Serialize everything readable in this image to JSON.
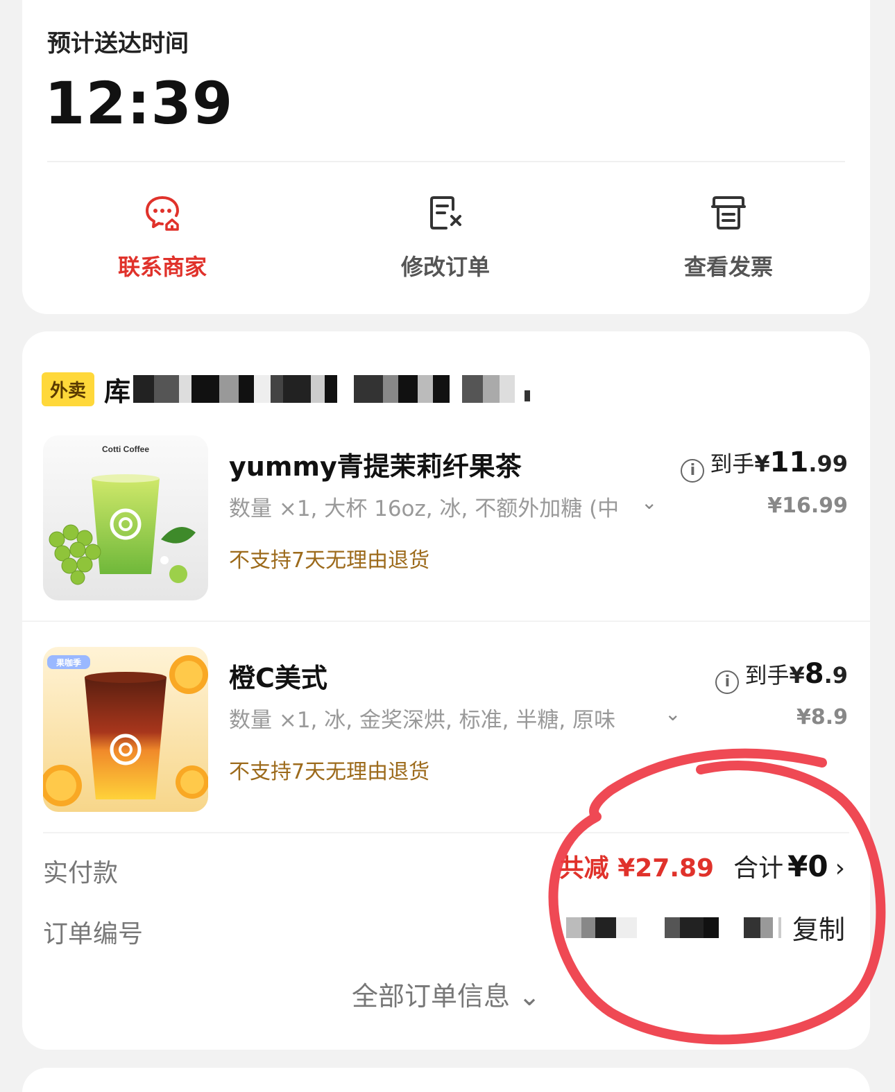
{
  "delivery": {
    "eta_label": "预计送达时间",
    "eta_time": "12:39",
    "actions": [
      {
        "label": "联系商家",
        "icon": "chat-merchant-icon",
        "color": "#e0322b"
      },
      {
        "label": "修改订单",
        "icon": "edit-order-icon"
      },
      {
        "label": "查看发票",
        "icon": "invoice-icon"
      }
    ]
  },
  "order": {
    "tag": "外卖",
    "store_name_visible": "库",
    "items": [
      {
        "name": "yummy青提茉莉纤果茶",
        "brand_text": "Cotti Coffee",
        "spec": "数量 ×1, 大杯 16oz, 冰, 不额外加糖 (中",
        "note": "不支持7天无理由退货",
        "price_prefix": "到手",
        "price_currency": "¥",
        "price_int": "11",
        "price_dec": ".99",
        "orig_price": "¥16.99"
      },
      {
        "name": "橙C美式",
        "badge_text": "果咖季",
        "spec": "数量 ×1, 冰, 金奖深烘, 标准, 半糖, 原味",
        "note": "不支持7天无理由退货",
        "price_prefix": "到手",
        "price_currency": "¥",
        "price_int": "8",
        "price_dec": ".9",
        "orig_price": "¥8.9"
      }
    ],
    "payment": {
      "label": "实付款",
      "saved_text": "共减 ¥27.89",
      "total_label": "合计",
      "total_value": "¥0"
    },
    "order_number": {
      "label": "订单编号",
      "copy_label": "复制"
    },
    "all_info_label": "全部订单信息 ⌄"
  },
  "colors": {
    "accent_red": "#e0322b",
    "tag_yellow": "#ffd83a",
    "note_brown": "#9c6a1b",
    "annotation_red": "#ee3a45"
  }
}
